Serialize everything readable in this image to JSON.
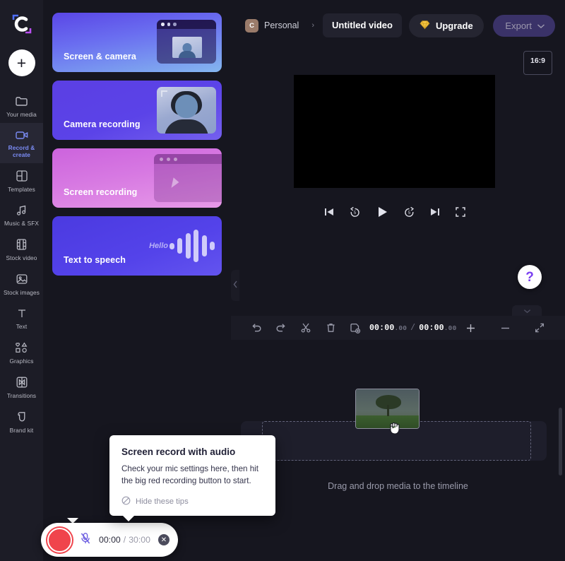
{
  "app": {
    "logo_icon": "clipchamp-logo"
  },
  "rail": {
    "add_button": {
      "label": "+",
      "icon": "plus-icon"
    },
    "items": [
      {
        "label": "Your media",
        "icon": "folder-icon",
        "active": false
      },
      {
        "label": "Record & create",
        "icon": "video-camera-icon",
        "active": true
      },
      {
        "label": "Templates",
        "icon": "templates-grid-icon",
        "active": false
      },
      {
        "label": "Music & SFX",
        "icon": "music-note-icon",
        "active": false
      },
      {
        "label": "Stock video",
        "icon": "film-strip-icon",
        "active": false
      },
      {
        "label": "Stock images",
        "icon": "image-icon",
        "active": false
      },
      {
        "label": "Text",
        "icon": "text-t-icon",
        "active": false
      },
      {
        "label": "Graphics",
        "icon": "shapes-icon",
        "active": false
      },
      {
        "label": "Transitions",
        "icon": "transitions-icon",
        "active": false
      },
      {
        "label": "Brand kit",
        "icon": "brand-kit-icon",
        "active": false
      }
    ]
  },
  "panel": {
    "cards": [
      {
        "title": "Screen & camera",
        "art": "screen-and-camera-art"
      },
      {
        "title": "Camera recording",
        "art": "camera-recording-art"
      },
      {
        "title": "Screen recording",
        "art": "screen-recording-art"
      },
      {
        "title": "Text to speech",
        "art": "text-to-speech-art",
        "art_text": "Hello"
      }
    ],
    "collapse_icon": "chevron-left-icon"
  },
  "topbar": {
    "workspace_initial": "C",
    "workspace_name": "Personal",
    "breadcrumb_sep": "›",
    "project_title": "Untitled video",
    "upgrade_label": "Upgrade",
    "upgrade_icon": "diamond-icon",
    "export_label": "Export",
    "export_chevron_icon": "chevron-down-icon"
  },
  "preview": {
    "aspect_ratio": "16:9",
    "controls": [
      {
        "name": "skip-to-start",
        "icon": "skip-previous-icon"
      },
      {
        "name": "rewind-5s",
        "icon": "replay-5-icon"
      },
      {
        "name": "play",
        "icon": "play-icon"
      },
      {
        "name": "forward-5s",
        "icon": "forward-5-icon"
      },
      {
        "name": "skip-to-end",
        "icon": "skip-next-icon"
      },
      {
        "name": "fullscreen",
        "icon": "fullscreen-icon"
      }
    ],
    "help_label": "?"
  },
  "timeline_toolbar": {
    "buttons": [
      {
        "name": "undo",
        "icon": "undo-icon"
      },
      {
        "name": "redo",
        "icon": "redo-icon"
      },
      {
        "name": "split",
        "icon": "scissors-icon"
      },
      {
        "name": "delete",
        "icon": "trash-icon"
      },
      {
        "name": "add-media",
        "icon": "add-media-icon"
      }
    ],
    "current_time": "00:00",
    "current_ms": ".00",
    "time_separator": "/",
    "total_time": "00:00",
    "total_ms": ".00",
    "zoom_in_icon": "plus-icon",
    "zoom_out_icon": "minus-icon",
    "fit_icon": "fit-to-screen-icon",
    "expand_icon": "chevron-down-icon"
  },
  "timeline": {
    "empty_message": "Drag and drop media to the timeline",
    "drag_item": "tree-thumbnail",
    "cursor": "grabbing-hand-cursor"
  },
  "tip": {
    "title": "Screen record with audio",
    "body": "Check your mic settings here, then hit the big red recording button to start.",
    "hide_label": "Hide these tips",
    "hide_icon": "block-icon"
  },
  "recorder": {
    "record_button": "record-button",
    "mic_icon": "mic-muted-icon",
    "elapsed": "00:00",
    "separator": "/",
    "limit": "30:00",
    "close_icon": "close-icon"
  },
  "colors": {
    "background": "#16161f",
    "rail": "#1c1c26",
    "accent_purple": "#7a3ff0",
    "record_red": "#f0444c",
    "active_nav_text": "#7b8cf5",
    "export_bg": "#3a3268"
  }
}
